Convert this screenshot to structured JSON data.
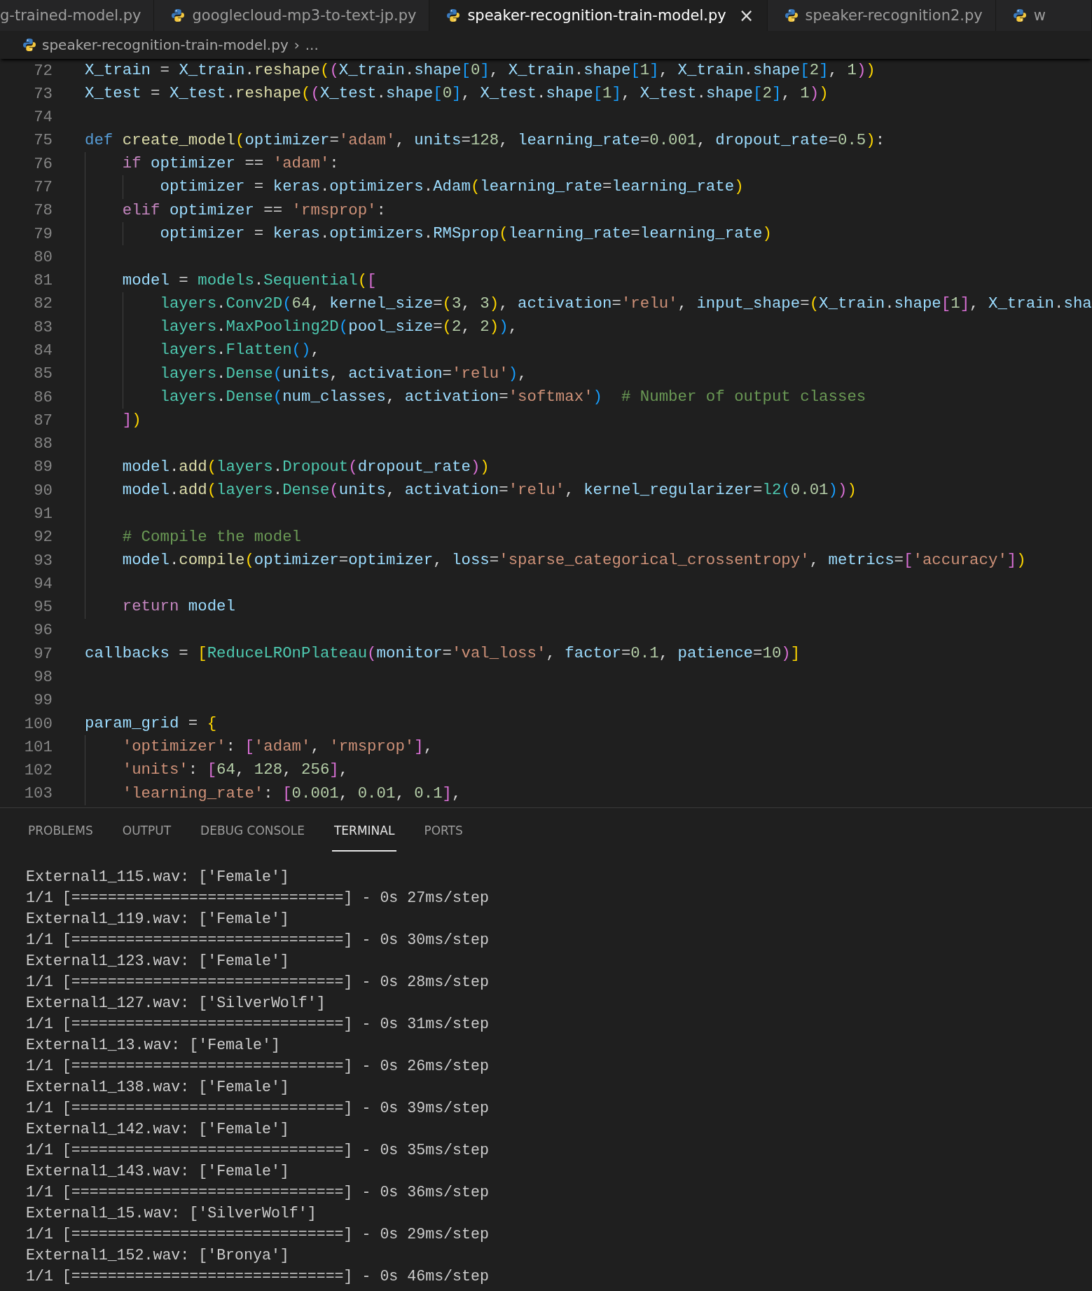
{
  "tabs": [
    {
      "label": "g-trained-model.py",
      "selected": false,
      "icon": false
    },
    {
      "label": "googlecloud-mp3-to-text-jp.py",
      "selected": false,
      "icon": true
    },
    {
      "label": "speaker-recognition-train-model.py",
      "selected": true,
      "icon": true,
      "close": "×"
    },
    {
      "label": "speaker-recognition2.py",
      "selected": false,
      "icon": true
    },
    {
      "label": "w",
      "selected": false,
      "icon": true
    }
  ],
  "breadcrumb": {
    "file": "speaker-recognition-train-model.py",
    "separator": "›",
    "rest": "..."
  },
  "code": [
    {
      "number": "72",
      "kind": "top",
      "tokens": [
        {
          "text": "X_train",
          "kind": "var"
        },
        {
          "text": " = ",
          "kind": "p"
        },
        {
          "text": "X_train",
          "kind": "var"
        },
        {
          "text": ".",
          "kind": "p"
        },
        {
          "text": "reshape",
          "kind": "fn"
        },
        {
          "text": "(",
          "kind": "b1"
        },
        {
          "text": "(",
          "kind": "b2"
        },
        {
          "text": "X_train",
          "kind": "var"
        },
        {
          "text": ".",
          "kind": "p"
        },
        {
          "text": "shape",
          "kind": "var"
        },
        {
          "text": "[",
          "kind": "b3"
        },
        {
          "text": "0",
          "kind": "num"
        },
        {
          "text": "]",
          "kind": "b3"
        },
        {
          "text": ", ",
          "kind": "p"
        },
        {
          "text": "X_train",
          "kind": "var"
        },
        {
          "text": ".",
          "kind": "p"
        },
        {
          "text": "shape",
          "kind": "var"
        },
        {
          "text": "[",
          "kind": "b3"
        },
        {
          "text": "1",
          "kind": "num"
        },
        {
          "text": "]",
          "kind": "b3"
        },
        {
          "text": ", ",
          "kind": "p"
        },
        {
          "text": "X_train",
          "kind": "var"
        },
        {
          "text": ".",
          "kind": "p"
        },
        {
          "text": "shape",
          "kind": "var"
        },
        {
          "text": "[",
          "kind": "b3"
        },
        {
          "text": "2",
          "kind": "num"
        },
        {
          "text": "]",
          "kind": "b3"
        },
        {
          "text": ", ",
          "kind": "p"
        },
        {
          "text": "1",
          "kind": "num"
        },
        {
          "text": ")",
          "kind": "b2"
        },
        {
          "text": ")",
          "kind": "b1"
        }
      ]
    },
    {
      "number": "73",
      "kind": "top",
      "tokens": [
        {
          "text": "X_test",
          "kind": "var"
        },
        {
          "text": " = ",
          "kind": "p"
        },
        {
          "text": "X_test",
          "kind": "var"
        },
        {
          "text": ".",
          "kind": "p"
        },
        {
          "text": "reshape",
          "kind": "fn"
        },
        {
          "text": "(",
          "kind": "b1"
        },
        {
          "text": "(",
          "kind": "b2"
        },
        {
          "text": "X_test",
          "kind": "var"
        },
        {
          "text": ".",
          "kind": "p"
        },
        {
          "text": "shape",
          "kind": "var"
        },
        {
          "text": "[",
          "kind": "b3"
        },
        {
          "text": "0",
          "kind": "num"
        },
        {
          "text": "]",
          "kind": "b3"
        },
        {
          "text": ", ",
          "kind": "p"
        },
        {
          "text": "X_test",
          "kind": "var"
        },
        {
          "text": ".",
          "kind": "p"
        },
        {
          "text": "shape",
          "kind": "var"
        },
        {
          "text": "[",
          "kind": "b3"
        },
        {
          "text": "1",
          "kind": "num"
        },
        {
          "text": "]",
          "kind": "b3"
        },
        {
          "text": ", ",
          "kind": "p"
        },
        {
          "text": "X_test",
          "kind": "var"
        },
        {
          "text": ".",
          "kind": "p"
        },
        {
          "text": "shape",
          "kind": "var"
        },
        {
          "text": "[",
          "kind": "b3"
        },
        {
          "text": "2",
          "kind": "num"
        },
        {
          "text": "]",
          "kind": "b3"
        },
        {
          "text": ", ",
          "kind": "p"
        },
        {
          "text": "1",
          "kind": "num"
        },
        {
          "text": ")",
          "kind": "b2"
        },
        {
          "text": ")",
          "kind": "b1"
        }
      ]
    },
    {
      "number": "74",
      "kind": "top"
    },
    {
      "number": "75",
      "kind": "top",
      "tokens": [
        {
          "text": "def ",
          "kind": "kw"
        },
        {
          "text": "create_model",
          "kind": "fn"
        },
        {
          "text": "(",
          "kind": "b1"
        },
        {
          "text": "optimizer",
          "kind": "var"
        },
        {
          "text": "=",
          "kind": "p"
        },
        {
          "text": "'adam'",
          "kind": "str"
        },
        {
          "text": ", ",
          "kind": "p"
        },
        {
          "text": "units",
          "kind": "var"
        },
        {
          "text": "=",
          "kind": "p"
        },
        {
          "text": "128",
          "kind": "num"
        },
        {
          "text": ", ",
          "kind": "p"
        },
        {
          "text": "learning_rate",
          "kind": "var"
        },
        {
          "text": "=",
          "kind": "p"
        },
        {
          "text": "0.001",
          "kind": "num"
        },
        {
          "text": ", ",
          "kind": "p"
        },
        {
          "text": "dropout_rate",
          "kind": "var"
        },
        {
          "text": "=",
          "kind": "p"
        },
        {
          "text": "0.5",
          "kind": "num"
        },
        {
          "text": ")",
          "kind": "b1"
        },
        {
          "text": ":",
          "kind": "p"
        }
      ]
    },
    {
      "number": "76",
      "kind": "body",
      "tokens": [
        {
          "text": "if ",
          "kind": "ctl"
        },
        {
          "text": "optimizer",
          "kind": "var"
        },
        {
          "text": " == ",
          "kind": "p"
        },
        {
          "text": "'adam'",
          "kind": "str"
        },
        {
          "text": ":",
          "kind": "p"
        }
      ]
    },
    {
      "number": "77",
      "kind": "inner",
      "tokens": [
        {
          "text": "optimizer",
          "kind": "var"
        },
        {
          "text": " = ",
          "kind": "p"
        },
        {
          "text": "keras",
          "kind": "var"
        },
        {
          "text": ".",
          "kind": "p"
        },
        {
          "text": "optimizers",
          "kind": "var"
        },
        {
          "text": ".",
          "kind": "p"
        },
        {
          "text": "Adam",
          "kind": "var"
        },
        {
          "text": "(",
          "kind": "b1"
        },
        {
          "text": "learning_rate",
          "kind": "var"
        },
        {
          "text": "=",
          "kind": "p"
        },
        {
          "text": "learning_rate",
          "kind": "var"
        },
        {
          "text": ")",
          "kind": "b1"
        }
      ]
    },
    {
      "number": "78",
      "kind": "body",
      "tokens": [
        {
          "text": "elif ",
          "kind": "ctl"
        },
        {
          "text": "optimizer",
          "kind": "var"
        },
        {
          "text": " == ",
          "kind": "p"
        },
        {
          "text": "'rmsprop'",
          "kind": "str"
        },
        {
          "text": ":",
          "kind": "p"
        }
      ]
    },
    {
      "number": "79",
      "kind": "inner",
      "tokens": [
        {
          "text": "optimizer",
          "kind": "var"
        },
        {
          "text": " = ",
          "kind": "p"
        },
        {
          "text": "keras",
          "kind": "var"
        },
        {
          "text": ".",
          "kind": "p"
        },
        {
          "text": "optimizers",
          "kind": "var"
        },
        {
          "text": ".",
          "kind": "p"
        },
        {
          "text": "RMSprop",
          "kind": "var"
        },
        {
          "text": "(",
          "kind": "b1"
        },
        {
          "text": "learning_rate",
          "kind": "var"
        },
        {
          "text": "=",
          "kind": "p"
        },
        {
          "text": "learning_rate",
          "kind": "var"
        },
        {
          "text": ")",
          "kind": "b1"
        }
      ]
    },
    {
      "number": "80",
      "kind": "body"
    },
    {
      "number": "81",
      "kind": "body",
      "tokens": [
        {
          "text": "model",
          "kind": "var"
        },
        {
          "text": " = ",
          "kind": "p"
        },
        {
          "text": "models",
          "kind": "cls"
        },
        {
          "text": ".",
          "kind": "p"
        },
        {
          "text": "Sequential",
          "kind": "cls"
        },
        {
          "text": "(",
          "kind": "b1"
        },
        {
          "text": "[",
          "kind": "b2"
        }
      ]
    },
    {
      "number": "82",
      "kind": "inner",
      "tokens": [
        {
          "text": "layers",
          "kind": "cls"
        },
        {
          "text": ".",
          "kind": "p"
        },
        {
          "text": "Conv2D",
          "kind": "cls"
        },
        {
          "text": "(",
          "kind": "b3"
        },
        {
          "text": "64",
          "kind": "num"
        },
        {
          "text": ", ",
          "kind": "p"
        },
        {
          "text": "kernel_size",
          "kind": "var"
        },
        {
          "text": "=",
          "kind": "p"
        },
        {
          "text": "(",
          "kind": "b1"
        },
        {
          "text": "3",
          "kind": "num"
        },
        {
          "text": ", ",
          "kind": "p"
        },
        {
          "text": "3",
          "kind": "num"
        },
        {
          "text": ")",
          "kind": "b1"
        },
        {
          "text": ", ",
          "kind": "p"
        },
        {
          "text": "activation",
          "kind": "var"
        },
        {
          "text": "=",
          "kind": "p"
        },
        {
          "text": "'relu'",
          "kind": "str"
        },
        {
          "text": ", ",
          "kind": "p"
        },
        {
          "text": "input_shape",
          "kind": "var"
        },
        {
          "text": "=",
          "kind": "p"
        },
        {
          "text": "(",
          "kind": "b1"
        },
        {
          "text": "X_train",
          "kind": "var"
        },
        {
          "text": ".",
          "kind": "p"
        },
        {
          "text": "shape",
          "kind": "var"
        },
        {
          "text": "[",
          "kind": "b2"
        },
        {
          "text": "1",
          "kind": "num"
        },
        {
          "text": "]",
          "kind": "b2"
        },
        {
          "text": ", ",
          "kind": "p"
        },
        {
          "text": "X_train",
          "kind": "var"
        },
        {
          "text": ".",
          "kind": "p"
        },
        {
          "text": "sha",
          "kind": "var"
        }
      ]
    },
    {
      "number": "83",
      "kind": "inner",
      "tokens": [
        {
          "text": "layers",
          "kind": "cls"
        },
        {
          "text": ".",
          "kind": "p"
        },
        {
          "text": "MaxPooling2D",
          "kind": "cls"
        },
        {
          "text": "(",
          "kind": "b3"
        },
        {
          "text": "pool_size",
          "kind": "var"
        },
        {
          "text": "=",
          "kind": "p"
        },
        {
          "text": "(",
          "kind": "b1"
        },
        {
          "text": "2",
          "kind": "num"
        },
        {
          "text": ", ",
          "kind": "p"
        },
        {
          "text": "2",
          "kind": "num"
        },
        {
          "text": ")",
          "kind": "b1"
        },
        {
          "text": ")",
          "kind": "b3"
        },
        {
          "text": ",",
          "kind": "p"
        }
      ]
    },
    {
      "number": "84",
      "kind": "inner",
      "tokens": [
        {
          "text": "layers",
          "kind": "cls"
        },
        {
          "text": ".",
          "kind": "p"
        },
        {
          "text": "Flatten",
          "kind": "cls"
        },
        {
          "text": "(",
          "kind": "b3"
        },
        {
          "text": ")",
          "kind": "b3"
        },
        {
          "text": ",",
          "kind": "p"
        }
      ]
    },
    {
      "number": "85",
      "kind": "inner",
      "tokens": [
        {
          "text": "layers",
          "kind": "cls"
        },
        {
          "text": ".",
          "kind": "p"
        },
        {
          "text": "Dense",
          "kind": "cls"
        },
        {
          "text": "(",
          "kind": "b3"
        },
        {
          "text": "units",
          "kind": "var"
        },
        {
          "text": ", ",
          "kind": "p"
        },
        {
          "text": "activation",
          "kind": "var"
        },
        {
          "text": "=",
          "kind": "p"
        },
        {
          "text": "'relu'",
          "kind": "str"
        },
        {
          "text": ")",
          "kind": "b3"
        },
        {
          "text": ",",
          "kind": "p"
        }
      ]
    },
    {
      "number": "86",
      "kind": "inner",
      "tokens": [
        {
          "text": "layers",
          "kind": "cls"
        },
        {
          "text": ".",
          "kind": "p"
        },
        {
          "text": "Dense",
          "kind": "cls"
        },
        {
          "text": "(",
          "kind": "b3"
        },
        {
          "text": "num_classes",
          "kind": "var"
        },
        {
          "text": ", ",
          "kind": "p"
        },
        {
          "text": "activation",
          "kind": "var"
        },
        {
          "text": "=",
          "kind": "p"
        },
        {
          "text": "'softmax'",
          "kind": "str"
        },
        {
          "text": ")",
          "kind": "b3"
        },
        {
          "text": "  # Number of output classes",
          "kind": "cm"
        }
      ]
    },
    {
      "number": "87",
      "kind": "body",
      "tokens": [
        {
          "text": "]",
          "kind": "b2"
        },
        {
          "text": ")",
          "kind": "b1"
        }
      ]
    },
    {
      "number": "88",
      "kind": "body"
    },
    {
      "number": "89",
      "kind": "body",
      "tokens": [
        {
          "text": "model",
          "kind": "var"
        },
        {
          "text": ".",
          "kind": "p"
        },
        {
          "text": "add",
          "kind": "fn"
        },
        {
          "text": "(",
          "kind": "b1"
        },
        {
          "text": "layers",
          "kind": "cls"
        },
        {
          "text": ".",
          "kind": "p"
        },
        {
          "text": "Dropout",
          "kind": "cls"
        },
        {
          "text": "(",
          "kind": "b2"
        },
        {
          "text": "dropout_rate",
          "kind": "var"
        },
        {
          "text": ")",
          "kind": "b2"
        },
        {
          "text": ")",
          "kind": "b1"
        }
      ]
    },
    {
      "number": "90",
      "kind": "body",
      "tokens": [
        {
          "text": "model",
          "kind": "var"
        },
        {
          "text": ".",
          "kind": "p"
        },
        {
          "text": "add",
          "kind": "fn"
        },
        {
          "text": "(",
          "kind": "b1"
        },
        {
          "text": "layers",
          "kind": "cls"
        },
        {
          "text": ".",
          "kind": "p"
        },
        {
          "text": "Dense",
          "kind": "cls"
        },
        {
          "text": "(",
          "kind": "b2"
        },
        {
          "text": "units",
          "kind": "var"
        },
        {
          "text": ", ",
          "kind": "p"
        },
        {
          "text": "activation",
          "kind": "var"
        },
        {
          "text": "=",
          "kind": "p"
        },
        {
          "text": "'relu'",
          "kind": "str"
        },
        {
          "text": ", ",
          "kind": "p"
        },
        {
          "text": "kernel_regularizer",
          "kind": "var"
        },
        {
          "text": "=",
          "kind": "p"
        },
        {
          "text": "l2",
          "kind": "cls"
        },
        {
          "text": "(",
          "kind": "b3"
        },
        {
          "text": "0.01",
          "kind": "num"
        },
        {
          "text": ")",
          "kind": "b3"
        },
        {
          "text": ")",
          "kind": "b2"
        },
        {
          "text": ")",
          "kind": "b1"
        }
      ]
    },
    {
      "number": "91",
      "kind": "body"
    },
    {
      "number": "92",
      "kind": "body",
      "tokens": [
        {
          "text": "# Compile the model",
          "kind": "cm"
        }
      ]
    },
    {
      "number": "93",
      "kind": "body",
      "tokens": [
        {
          "text": "model",
          "kind": "var"
        },
        {
          "text": ".",
          "kind": "p"
        },
        {
          "text": "compile",
          "kind": "fn"
        },
        {
          "text": "(",
          "kind": "b1"
        },
        {
          "text": "optimizer",
          "kind": "var"
        },
        {
          "text": "=",
          "kind": "p"
        },
        {
          "text": "optimizer",
          "kind": "var"
        },
        {
          "text": ", ",
          "kind": "p"
        },
        {
          "text": "loss",
          "kind": "var"
        },
        {
          "text": "=",
          "kind": "p"
        },
        {
          "text": "'sparse_categorical_crossentropy'",
          "kind": "str"
        },
        {
          "text": ", ",
          "kind": "p"
        },
        {
          "text": "metrics",
          "kind": "var"
        },
        {
          "text": "=",
          "kind": "p"
        },
        {
          "text": "[",
          "kind": "b2"
        },
        {
          "text": "'accuracy'",
          "kind": "str"
        },
        {
          "text": "]",
          "kind": "b2"
        },
        {
          "text": ")",
          "kind": "b1"
        }
      ]
    },
    {
      "number": "94",
      "kind": "body"
    },
    {
      "number": "95",
      "kind": "body",
      "tokens": [
        {
          "text": "return ",
          "kind": "ctl"
        },
        {
          "text": "model",
          "kind": "var"
        }
      ]
    },
    {
      "number": "96",
      "kind": "top"
    },
    {
      "number": "97",
      "kind": "top",
      "tokens": [
        {
          "text": "callbacks",
          "kind": "var"
        },
        {
          "text": " = ",
          "kind": "p"
        },
        {
          "text": "[",
          "kind": "b1"
        },
        {
          "text": "ReduceLROnPlateau",
          "kind": "cls"
        },
        {
          "text": "(",
          "kind": "b2"
        },
        {
          "text": "monitor",
          "kind": "var"
        },
        {
          "text": "=",
          "kind": "p"
        },
        {
          "text": "'val_loss'",
          "kind": "str"
        },
        {
          "text": ", ",
          "kind": "p"
        },
        {
          "text": "factor",
          "kind": "var"
        },
        {
          "text": "=",
          "kind": "p"
        },
        {
          "text": "0.1",
          "kind": "num"
        },
        {
          "text": ", ",
          "kind": "p"
        },
        {
          "text": "patience",
          "kind": "var"
        },
        {
          "text": "=",
          "kind": "p"
        },
        {
          "text": "10",
          "kind": "num"
        },
        {
          "text": ")",
          "kind": "b2"
        },
        {
          "text": "]",
          "kind": "b1"
        }
      ]
    },
    {
      "number": "98",
      "kind": "top"
    },
    {
      "number": "99",
      "kind": "top"
    },
    {
      "number": "100",
      "kind": "top",
      "tokens": [
        {
          "text": "param_grid",
          "kind": "var"
        },
        {
          "text": " = ",
          "kind": "p"
        },
        {
          "text": "{",
          "kind": "b1"
        }
      ]
    },
    {
      "number": "101",
      "kind": "body",
      "tokens": [
        {
          "text": "'optimizer'",
          "kind": "str"
        },
        {
          "text": ": ",
          "kind": "p"
        },
        {
          "text": "[",
          "kind": "b2"
        },
        {
          "text": "'adam'",
          "kind": "str"
        },
        {
          "text": ", ",
          "kind": "p"
        },
        {
          "text": "'rmsprop'",
          "kind": "str"
        },
        {
          "text": "]",
          "kind": "b2"
        },
        {
          "text": ",",
          "kind": "p"
        }
      ]
    },
    {
      "number": "102",
      "kind": "body",
      "tokens": [
        {
          "text": "'units'",
          "kind": "str"
        },
        {
          "text": ": ",
          "kind": "p"
        },
        {
          "text": "[",
          "kind": "b2"
        },
        {
          "text": "64",
          "kind": "num"
        },
        {
          "text": ", ",
          "kind": "p"
        },
        {
          "text": "128",
          "kind": "num"
        },
        {
          "text": ", ",
          "kind": "p"
        },
        {
          "text": "256",
          "kind": "num"
        },
        {
          "text": "]",
          "kind": "b2"
        },
        {
          "text": ",",
          "kind": "p"
        }
      ]
    },
    {
      "number": "103",
      "kind": "body",
      "tokens": [
        {
          "text": "'learning_rate'",
          "kind": "str"
        },
        {
          "text": ": ",
          "kind": "p"
        },
        {
          "text": "[",
          "kind": "b2"
        },
        {
          "text": "0.001",
          "kind": "num"
        },
        {
          "text": ", ",
          "kind": "p"
        },
        {
          "text": "0.01",
          "kind": "num"
        },
        {
          "text": ", ",
          "kind": "p"
        },
        {
          "text": "0.1",
          "kind": "num"
        },
        {
          "text": "]",
          "kind": "b2"
        },
        {
          "text": ",",
          "kind": "p"
        }
      ]
    }
  ],
  "panel_tabs": [
    {
      "label": "PROBLEMS",
      "selected": false
    },
    {
      "label": "OUTPUT",
      "selected": false
    },
    {
      "label": "DEBUG CONSOLE",
      "selected": false
    },
    {
      "label": "TERMINAL",
      "selected": true
    },
    {
      "label": "PORTS",
      "selected": false
    }
  ],
  "terminal": [
    "External1_115.wav: ['Female']",
    "1/1 [==============================] - 0s 27ms/step",
    "External1_119.wav: ['Female']",
    "1/1 [==============================] - 0s 30ms/step",
    "External1_123.wav: ['Female']",
    "1/1 [==============================] - 0s 28ms/step",
    "External1_127.wav: ['SilverWolf']",
    "1/1 [==============================] - 0s 31ms/step",
    "External1_13.wav: ['Female']",
    "1/1 [==============================] - 0s 26ms/step",
    "External1_138.wav: ['Female']",
    "1/1 [==============================] - 0s 39ms/step",
    "External1_142.wav: ['Female']",
    "1/1 [==============================] - 0s 35ms/step",
    "External1_143.wav: ['Female']",
    "1/1 [==============================] - 0s 36ms/step",
    "External1_15.wav: ['SilverWolf']",
    "1/1 [==============================] - 0s 29ms/step",
    "External1_152.wav: ['Bronya']",
    "1/1 [==============================] - 0s 46ms/step"
  ]
}
